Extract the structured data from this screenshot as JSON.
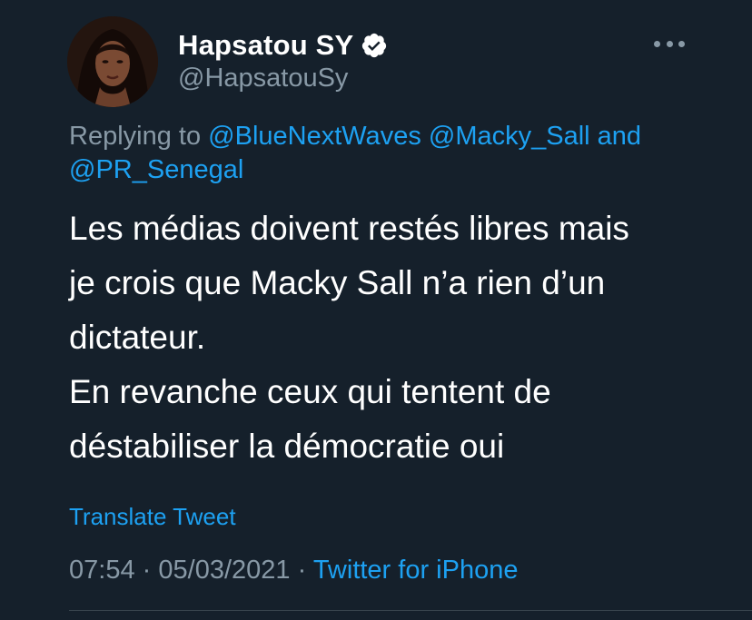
{
  "author": {
    "display_name": "Hapsatou SY",
    "handle": "@HapsatouSy",
    "verified": true,
    "avatar": "profile-photo"
  },
  "replying": {
    "prefix": "Replying to",
    "mentions": [
      "@BlueNextWaves",
      "@Macky_Sall"
    ],
    "conjunction": "and",
    "last_mention": "@PR_Senegal"
  },
  "tweet": {
    "lines": [
      "Les médias doivent restés libres mais",
      "je crois que Macky Sall n’a rien d’un",
      "dictateur.",
      "En revanche ceux qui tentent de",
      "déstabiliser la démocratie oui"
    ]
  },
  "translate_label": "Translate Tweet",
  "meta": {
    "time": "07:54",
    "separator": "·",
    "date": "05/03/2021",
    "source": "Twitter for iPhone"
  },
  "colors": {
    "background": "#15202b",
    "accent": "#1da1f2",
    "secondary_text": "#8899a6",
    "primary_text": "#ffffff"
  },
  "icons": {
    "verified": "verified-badge-icon",
    "more": "more-options-icon"
  }
}
